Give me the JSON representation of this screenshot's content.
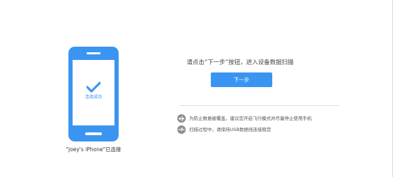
{
  "phone": {
    "status_text": "连接成功"
  },
  "device": {
    "connected_label": "\"joey's iPhone\"已连接"
  },
  "main": {
    "instruction": "请点击“下一步”按钮，进入设备数据扫描",
    "next_button_label": "下一步"
  },
  "tips": [
    {
      "icon": "airplane-icon",
      "text": "为防止数据被覆盖，建议您开启飞行模式并尽量停止使用手机"
    },
    {
      "icon": "usb-icon",
      "text": "扫描过程中，请保持USB数据线连接稳定"
    }
  ],
  "colors": {
    "accent": "#3a95f2",
    "tip_icon_bg": "#8c8c8c",
    "background": "#ffffff"
  }
}
